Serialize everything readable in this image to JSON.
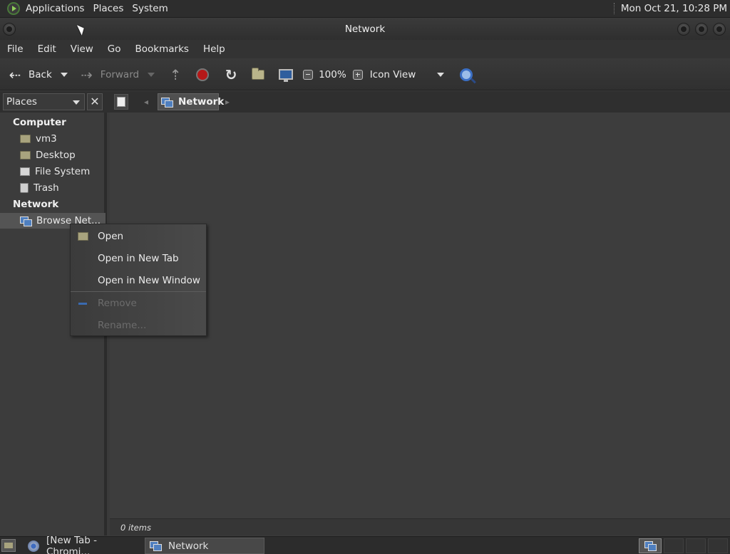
{
  "top_panel": {
    "menus": [
      "Applications",
      "Places",
      "System"
    ],
    "clock": "Mon Oct 21, 10:28 PM"
  },
  "window": {
    "title": "Network"
  },
  "menubar": {
    "items": [
      "File",
      "Edit",
      "View",
      "Go",
      "Bookmarks",
      "Help"
    ]
  },
  "toolbar": {
    "back_label": "Back",
    "forward_label": "Forward",
    "zoom_level": "100%",
    "view_mode": "Icon View"
  },
  "location": {
    "sidebar_selector": "Places",
    "current_crumb": "Network"
  },
  "sidebar": {
    "computer_heading": "Computer",
    "computer_items": [
      {
        "label": "vm3",
        "icon": "home-folder-icon"
      },
      {
        "label": "Desktop",
        "icon": "desktop-folder-icon"
      },
      {
        "label": "File System",
        "icon": "drive-icon"
      },
      {
        "label": "Trash",
        "icon": "trash-icon"
      }
    ],
    "network_heading": "Network",
    "network_items": [
      {
        "label": "Browse Net...",
        "icon": "network-icon",
        "selected": true
      }
    ]
  },
  "context_menu": {
    "items": [
      {
        "label": "Open",
        "enabled": true
      },
      {
        "label": "Open in New Tab",
        "enabled": true
      },
      {
        "label": "Open in New Window",
        "enabled": true
      },
      {
        "label": "Remove",
        "enabled": false
      },
      {
        "label": "Rename...",
        "enabled": false
      }
    ]
  },
  "status": {
    "text": "0 items"
  },
  "taskbar": {
    "tasks": [
      {
        "label": "[New Tab - Chromi...",
        "icon": "chromium-icon",
        "active": false
      },
      {
        "label": "Network",
        "icon": "network-icon",
        "active": true
      }
    ]
  }
}
